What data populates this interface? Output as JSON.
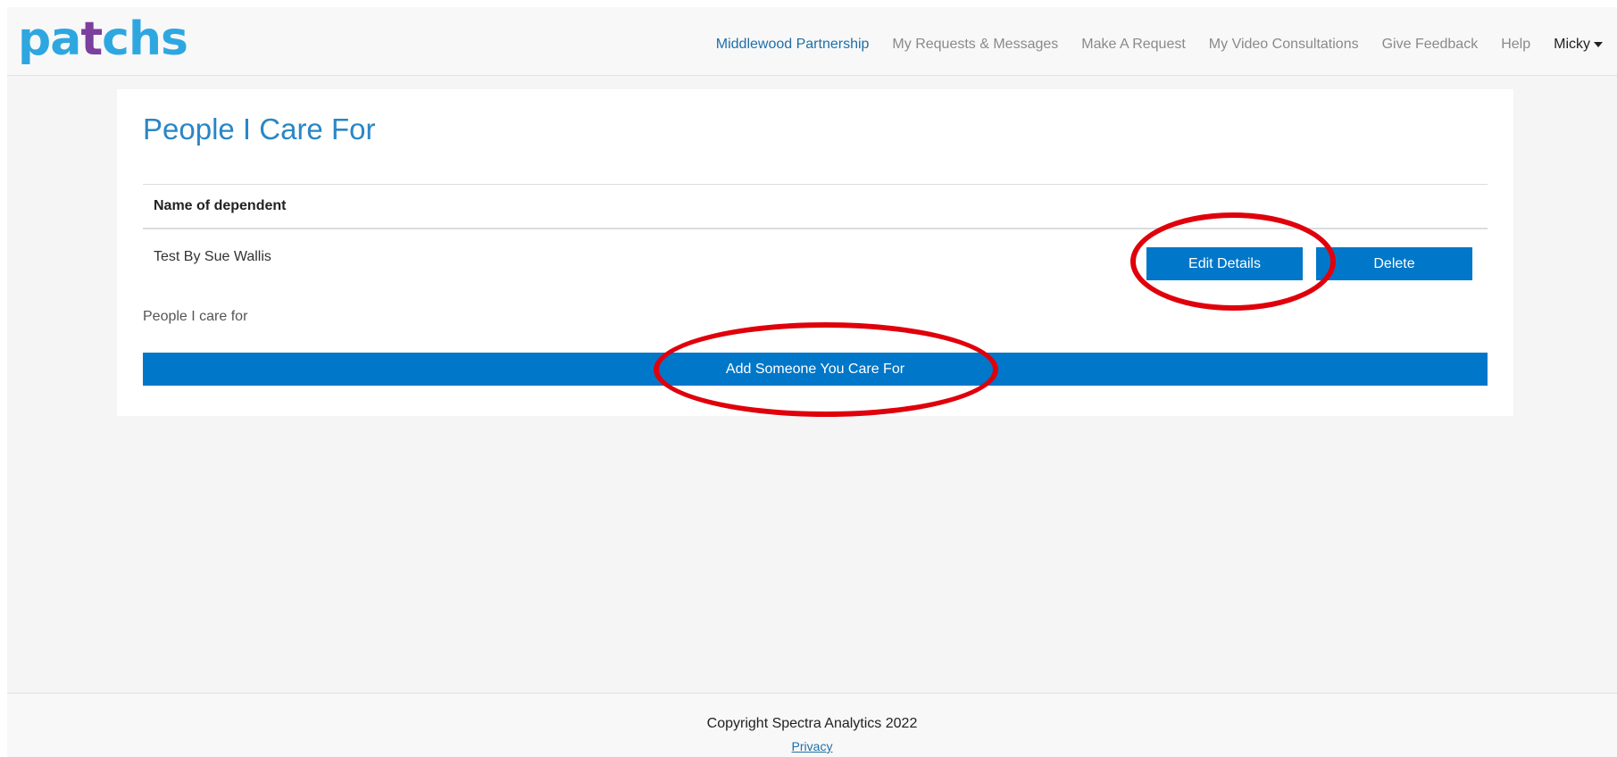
{
  "header": {
    "logo_prefix": "pa",
    "logo_mark": "t",
    "logo_suffix": "chs",
    "nav": [
      {
        "label": "Middlewood Partnership"
      },
      {
        "label": "My Requests & Messages"
      },
      {
        "label": "Make A Request"
      },
      {
        "label": "My Video Consultations"
      },
      {
        "label": "Give Feedback"
      },
      {
        "label": "Help"
      },
      {
        "label": "Micky"
      }
    ]
  },
  "main": {
    "title": "People I Care For",
    "table": {
      "column_header": "Name of dependent",
      "rows": [
        {
          "name": "Test By Sue Wallis",
          "edit_label": "Edit Details",
          "delete_label": "Delete"
        }
      ]
    },
    "caption": "People I care for",
    "add_button": "Add Someone You Care For"
  },
  "footer": {
    "copyright": "Copyright Spectra Analytics 2022",
    "privacy": "Privacy"
  },
  "colors": {
    "brand_blue": "#2ea7e0",
    "brand_purple": "#7b3f9e",
    "button_blue": "#0077c8",
    "highlight_red": "#e0000b"
  }
}
